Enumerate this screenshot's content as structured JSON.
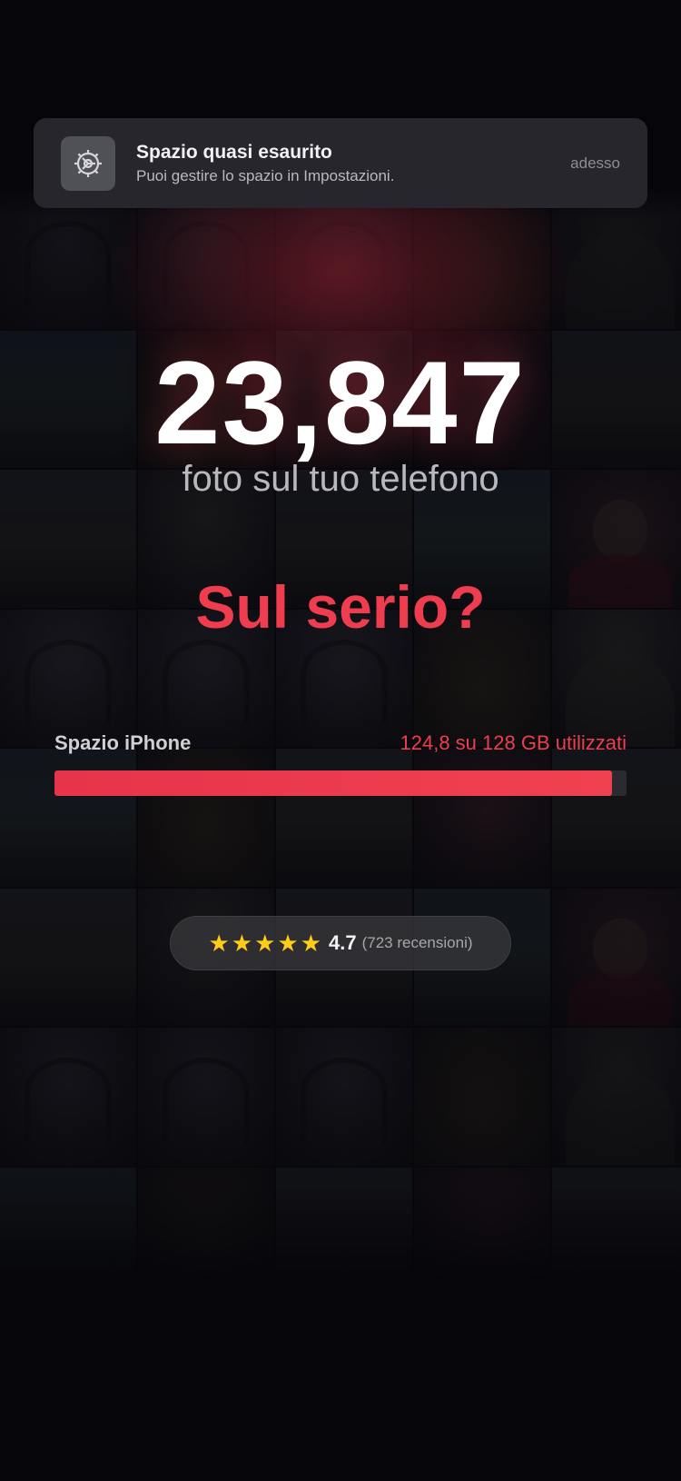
{
  "notification": {
    "icon": "gear-icon",
    "title": "Spazio quasi esaurito",
    "body": "Puoi gestire lo spazio in Impostazioni.",
    "time": "adesso"
  },
  "hero": {
    "count": "23,847",
    "subtitle": "foto sul tuo telefono",
    "headline": "Sul serio?"
  },
  "storage": {
    "label": "Spazio iPhone",
    "value_text": "124,8 su 128 GB utilizzati",
    "used_gb": 124.8,
    "total_gb": 128
  },
  "rating": {
    "stars": "★★★★★",
    "score": "4.7",
    "count": "(723 recensioni)"
  },
  "colors": {
    "accent": "#ef3d50",
    "star": "#ffcc1a",
    "background": "#05050a"
  }
}
